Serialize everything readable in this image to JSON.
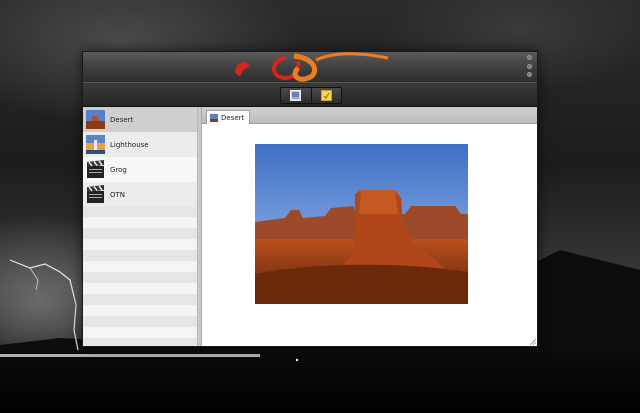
{
  "app": {
    "window_controls": [
      "minimize",
      "maximize",
      "close"
    ],
    "toolbar": {
      "buttons": [
        {
          "name": "photo-view",
          "icon": "image-icon"
        },
        {
          "name": "notes",
          "icon": "note-icon"
        }
      ]
    }
  },
  "sidebar": {
    "items": [
      {
        "label": "Desert",
        "icon": "desert-thumbnail",
        "selected": true
      },
      {
        "label": "Lighthouse",
        "icon": "lighthouse-thumbnail",
        "selected": false
      },
      {
        "label": "Grog",
        "icon": "clapperboard-icon",
        "selected": false
      },
      {
        "label": "OTN",
        "icon": "clapperboard-icon",
        "selected": false
      }
    ]
  },
  "content": {
    "tabs": [
      {
        "label": "Desert",
        "icon": "desert-thumbnail",
        "active": true
      }
    ],
    "viewer": {
      "image": "desert-photo"
    }
  },
  "colors": {
    "titlebar": "#3e3e3e",
    "logo_red": "#d9231f",
    "logo_orange": "#f07c1e",
    "selected_row": "#cfcfcf",
    "content_bg": "#ffffff"
  }
}
